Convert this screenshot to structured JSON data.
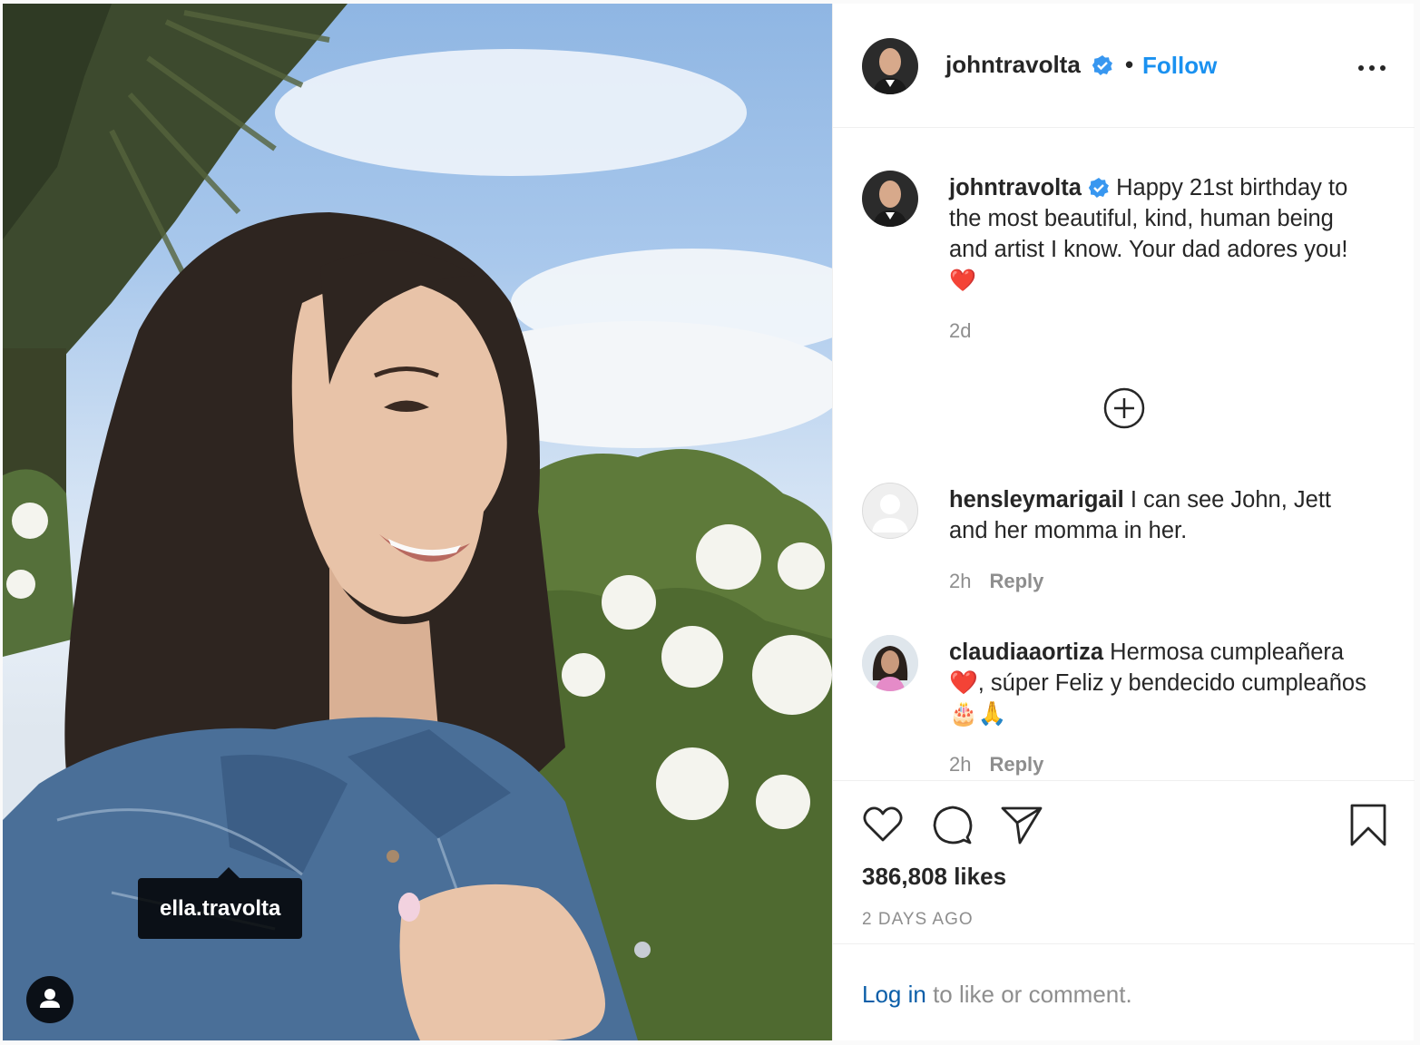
{
  "photo": {
    "tag_label": "ella.travolta",
    "user_tag_icon": "person-icon"
  },
  "header": {
    "username": "johntravolta",
    "verified_icon": "verified-badge-icon",
    "separator": "•",
    "follow_label": "Follow",
    "more_icon": "more-options-icon"
  },
  "caption": {
    "username": "johntravolta",
    "text": "Happy 21st birthday to the most beautiful, kind, human being and artist I know. Your dad adores you!",
    "emoji": "❤️",
    "time": "2d"
  },
  "load_more_icon": "plus-circle-icon",
  "comments": [
    {
      "username": "hensleymarigail",
      "text": "I can see John, Jett and her momma in her.",
      "time": "2h",
      "reply_label": "Reply"
    },
    {
      "username": "claudiaaortiza",
      "text": "Hermosa cumpleañera❤️, súper Feliz y bendecido cumpleaños 🎂🙏",
      "time": "2h",
      "reply_label": "Reply"
    }
  ],
  "actions": {
    "like_icon": "heart-icon",
    "comment_icon": "comment-icon",
    "share_icon": "send-icon",
    "save_icon": "bookmark-icon",
    "likes_text": "386,808 likes",
    "time_ago": "2 DAYS AGO"
  },
  "login": {
    "link_label": "Log in",
    "rest_text": "to like or comment."
  },
  "colors": {
    "accent_blue": "#1a91f0",
    "link_blue": "#0b5ea8",
    "secondary_text": "#8e8e8e",
    "primary_text": "#262626"
  }
}
